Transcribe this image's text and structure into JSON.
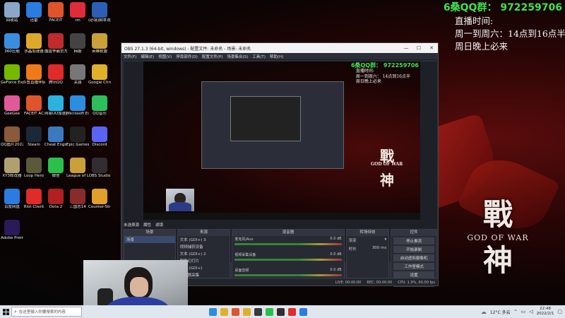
{
  "overlay": {
    "qq_group": "6桑QQ群： 972259706",
    "schedule_title": "直播时间:",
    "schedule_weekday": "周一到周六：14点到16点半",
    "schedule_weekend": "周日晚上必来"
  },
  "wallpaper": {
    "logo_char_top": "戰",
    "logo_subtitle": "GOD OF WAR",
    "logo_char_bottom": "神"
  },
  "desktop_icons": [
    {
      "label": "回收站",
      "icon": "recycle-bin-icon",
      "color": "#8aa7c9"
    },
    {
      "label": "迅雷",
      "icon": "xunlei-icon",
      "color": "#2b7be0"
    },
    {
      "label": "FACEIT",
      "icon": "faceit-icon",
      "color": "#e0542b"
    },
    {
      "label": "rm",
      "icon": "heart-icon",
      "color": "#e02b3a"
    },
    {
      "label": "(必填)脚本说明",
      "icon": "word-doc-icon",
      "color": "#2b5fb3"
    },
    {
      "label": "360压缩",
      "icon": "archive-icon",
      "color": "#3a8ee0"
    },
    {
      "label": "水晶加速器",
      "icon": "crystal-icon",
      "color": "#e0a82b"
    },
    {
      "label": "魔兽争霸官方对战平台",
      "icon": "warcraft-icon",
      "color": "#c02b2b"
    },
    {
      "label": "韩服",
      "icon": "korea-icon",
      "color": "#444444"
    },
    {
      "label": "英雄联盟",
      "icon": "lol-icon",
      "color": "#c9a03a"
    },
    {
      "label": "GeForce Experience",
      "icon": "nvidia-icon",
      "color": "#76b900"
    },
    {
      "label": "斗鱼直播伴侣",
      "icon": "douyu-icon",
      "color": "#f07a1a"
    },
    {
      "label": "腾讯QQ",
      "icon": "qq-icon",
      "color": "#e02b2b"
    },
    {
      "label": "关弱",
      "icon": "folder-icon",
      "color": "#777777"
    },
    {
      "label": "Google Chrome",
      "icon": "chrome-icon",
      "color": "#e0b02b"
    },
    {
      "label": "GeeGee",
      "icon": "geegee-icon",
      "color": "#e05a9a"
    },
    {
      "label": "FACEIT AC",
      "icon": "faceit-ac-icon",
      "color": "#e0542b"
    },
    {
      "label": "网易UU加速器",
      "icon": "uu-icon",
      "color": "#2bb3e0"
    },
    {
      "label": "Microsoft Edge",
      "icon": "edge-icon",
      "color": "#2b8ee0"
    },
    {
      "label": "QQ音乐",
      "icon": "qqmusic-icon",
      "color": "#2bc05a"
    },
    {
      "label": "QQ图片20220705...",
      "icon": "image-icon",
      "color": "#8a5a3a"
    },
    {
      "label": "Steam",
      "icon": "steam-icon",
      "color": "#1b2838"
    },
    {
      "label": "Cheat Engine",
      "icon": "cheat-engine-icon",
      "color": "#3a7ac0"
    },
    {
      "label": "Epic Games Launcher",
      "icon": "epic-icon",
      "color": "#222222"
    },
    {
      "label": "Discord",
      "icon": "discord-icon",
      "color": "#5865f2"
    },
    {
      "label": "XY3修改器",
      "icon": "xy3-icon",
      "color": "#b0a070"
    },
    {
      "label": "Loop Hero",
      "icon": "loop-hero-icon",
      "color": "#5a5a3a"
    },
    {
      "label": "微信",
      "icon": "wechat-icon",
      "color": "#2bc04a"
    },
    {
      "label": "League of Legends",
      "icon": "league-icon",
      "color": "#c9a03a"
    },
    {
      "label": "OBS Studio",
      "icon": "obs-icon",
      "color": "#302e31"
    },
    {
      "label": "百度网盘",
      "icon": "baidu-pan-icon",
      "color": "#2b7be0"
    },
    {
      "label": "Riot Client",
      "icon": "riot-icon",
      "color": "#e02b2b"
    },
    {
      "label": "Dota 2",
      "icon": "dota-icon",
      "color": "#b02020"
    },
    {
      "label": "三国志14",
      "icon": "sanguo-icon",
      "color": "#8a2b2b"
    },
    {
      "label": "Counter-Strike Global Off...",
      "icon": "csgo-icon",
      "color": "#e0a02b"
    },
    {
      "label": "Adobe Premie...",
      "icon": "premiere-icon",
      "color": "#2a1a5a"
    }
  ],
  "obs": {
    "title": "OBS 27.1.3 (64-bit, windows) - 配置文件: 未命名 - 场景: 未命名",
    "menu": [
      "文件(F)",
      "编辑(E)",
      "视图(V)",
      "停靠部件(D)",
      "配置文件(P)",
      "场景集合(S)",
      "工具(T)",
      "帮助(H)"
    ],
    "preview_qq": "6桑QQ群： 972259706",
    "preview_sched": [
      "直播时间:",
      "周一到周六： 14点到16点半",
      "周日晚上必来"
    ],
    "scene_header": "未选择源",
    "properties_label": "属性",
    "filters_label": "滤镜",
    "docks": {
      "scenes": "场景",
      "sources": "来源",
      "mixer": "混音器",
      "transitions": "转场特效",
      "controls": "控件"
    },
    "scene_items": [
      "场景"
    ],
    "source_items": [
      "文本 (GDI+) 3",
      "视频捕获设备",
      "文本 (GDI+) 2",
      "图像幻灯片",
      "文本 (GDI+)",
      "显示器采集"
    ],
    "mixer_tracks": [
      {
        "name": "麦克风/Aux",
        "db": "0.0 dB"
      },
      {
        "name": "视频采集设备",
        "db": "0.0 dB"
      },
      {
        "name": "桌面音频",
        "db": "0.0 dB"
      }
    ],
    "transition_type": "渐变",
    "duration_label": "时长",
    "duration_value": "300 ms",
    "controls": [
      "停止推流",
      "开始录制",
      "启动虚拟摄像机",
      "工作室模式",
      "设置",
      "退出"
    ],
    "status": [
      "LIVE: 00:00:00",
      "REC: 00:00:00",
      "CPU: 1.9%, 60.00 fps"
    ]
  },
  "taskbar": {
    "search_placeholder": "在这里输入你要搜索的内容",
    "weather": "12°C 多云",
    "time": "22:48",
    "date": "2022/2/1"
  }
}
